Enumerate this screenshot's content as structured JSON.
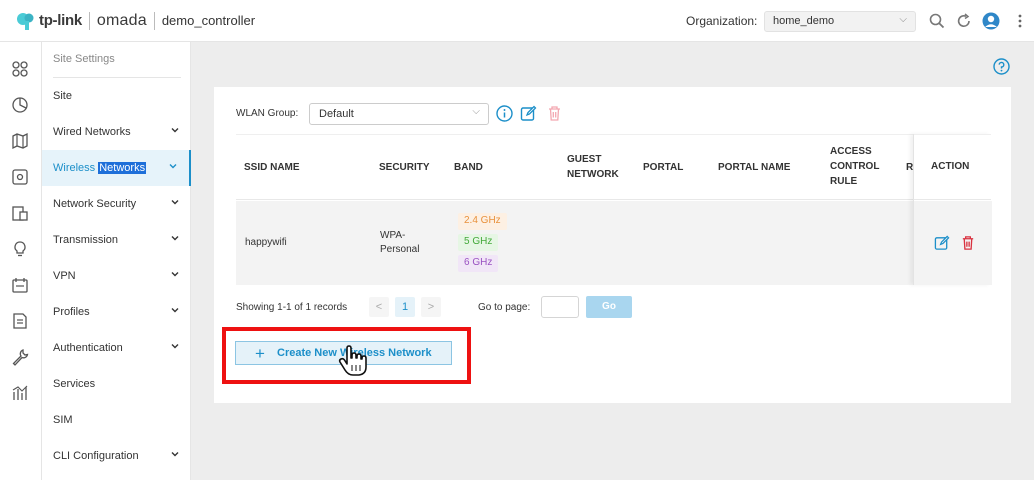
{
  "topbar": {
    "brand_tp": "tp-link",
    "brand_omada": "omada",
    "controller": "demo_controller",
    "org_label": "Organization:",
    "org_value": "home_demo"
  },
  "sidebar": {
    "header": "Site Settings",
    "items": [
      {
        "label": "Site",
        "arrow": false
      },
      {
        "label": "Wired Networks",
        "arrow": true
      },
      {
        "label": "Wireless Networks",
        "arrow": true
      },
      {
        "label": "Network Security",
        "arrow": true
      },
      {
        "label": "Transmission",
        "arrow": true
      },
      {
        "label": "VPN",
        "arrow": true
      },
      {
        "label": "Profiles",
        "arrow": true
      },
      {
        "label": "Authentication",
        "arrow": true
      },
      {
        "label": "Services",
        "arrow": false
      },
      {
        "label": "SIM",
        "arrow": false
      },
      {
        "label": "CLI Configuration",
        "arrow": true
      }
    ]
  },
  "wlan": {
    "label": "WLAN Group:",
    "value": "Default"
  },
  "table": {
    "headers": {
      "ssid": "SSID NAME",
      "security": "SECURITY",
      "band": "BAND",
      "guest_1": "GUEST",
      "guest_2": "NETWORK",
      "portal": "PORTAL",
      "portal_name": "PORTAL NAME",
      "acl_1": "ACCESS",
      "acl_2": "CONTROL",
      "acl_3": "RULE",
      "cut": "R",
      "action": "ACTION"
    },
    "rows": [
      {
        "ssid": "happywifi",
        "security_1": "WPA-",
        "security_2": "Personal",
        "bands": [
          "2.4 GHz",
          "5 GHz",
          "6 GHz"
        ]
      }
    ]
  },
  "pager": {
    "summary": "Showing 1-1 of 1 records",
    "prev": "<",
    "page": "1",
    "next": ">",
    "goto_label": "Go to page:",
    "go": "Go"
  },
  "create_button": "Create New Wireless Network",
  "colors": {
    "accent": "#1c8fc9",
    "band_24_bg": "#fdf0e3",
    "band_24_fg": "#e8913c",
    "band_5_bg": "#e6f6e4",
    "band_5_fg": "#43a93a",
    "band_6_bg": "#f1e6f7",
    "band_6_fg": "#9a52c2",
    "highlight": "#ee1111"
  }
}
